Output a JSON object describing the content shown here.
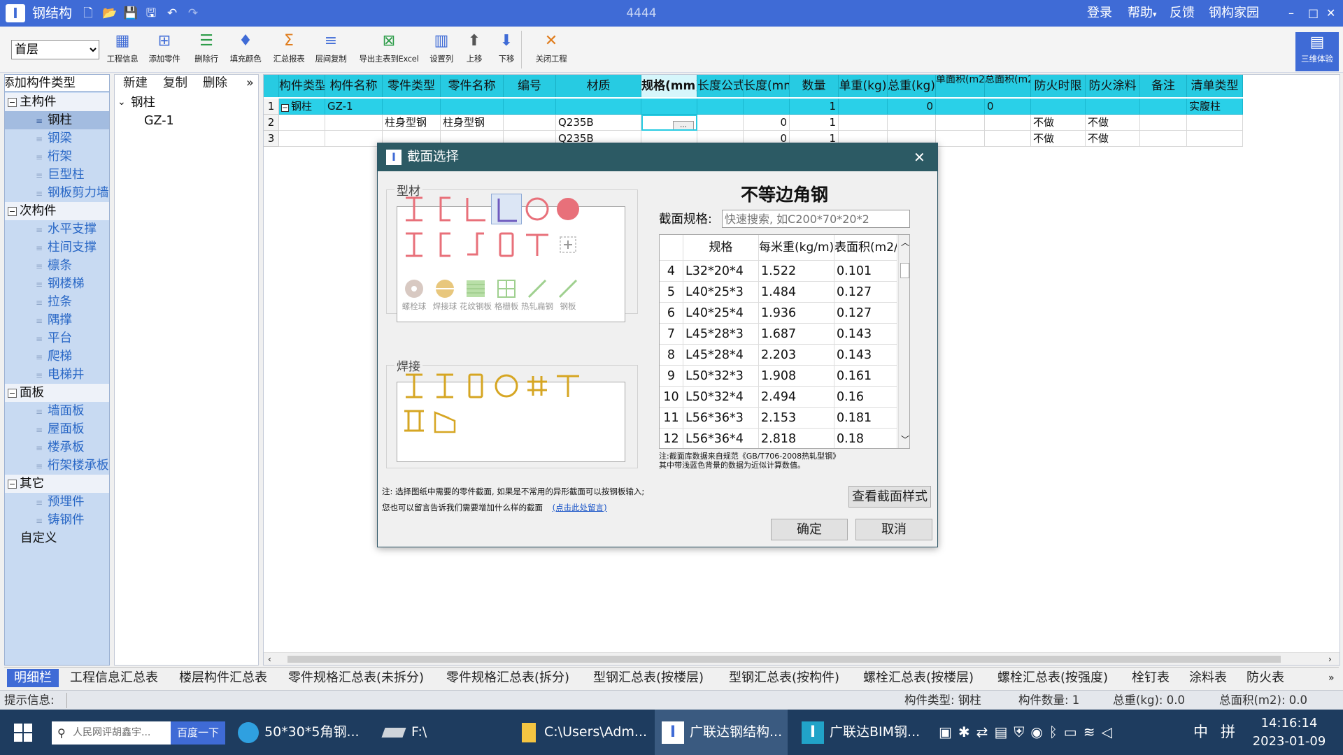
{
  "app": {
    "title": "钢结构",
    "doc_title": "4444",
    "menu": [
      "登录",
      "帮助",
      "反馈",
      "钢构家园"
    ],
    "window_controls": [
      "–",
      "□",
      "✕"
    ]
  },
  "toolbar": {
    "floor_select": "首层",
    "buttons": [
      {
        "label": "工程信息",
        "icon": "▦",
        "color": "#3f6bd6"
      },
      {
        "label": "添加零件",
        "icon": "⊞",
        "color": "#3f6bd6"
      },
      {
        "label": "删除行",
        "icon": "☰",
        "color": "#2e9d4a"
      },
      {
        "label": "填充颜色",
        "icon": "♦",
        "color": "#3f6bd6"
      },
      {
        "label": "汇总报表",
        "icon": "Σ",
        "color": "#e07b1a"
      },
      {
        "label": "层间复制",
        "icon": "≡",
        "color": "#3f6bd6"
      },
      {
        "label": "导出主表到Excel",
        "icon": "⊠",
        "color": "#2e9d4a"
      },
      {
        "label": "设置列",
        "icon": "▥",
        "color": "#3f6bd6"
      },
      {
        "label": "上移",
        "icon": "⬆",
        "color": "#555555"
      },
      {
        "label": "下移",
        "icon": "⬇",
        "color": "#3f6bd6"
      },
      {
        "label": "关闭工程",
        "icon": "✕",
        "color": "#e07b1a"
      }
    ],
    "view3d": "三维体验"
  },
  "left_tree": {
    "header": "添加构件类型",
    "items": [
      {
        "label": "主构件",
        "type": "group"
      },
      {
        "label": "钢柱",
        "type": "item",
        "selected": true
      },
      {
        "label": "钢梁",
        "type": "item"
      },
      {
        "label": "桁架",
        "type": "item"
      },
      {
        "label": "巨型柱",
        "type": "item"
      },
      {
        "label": "钢板剪力墙",
        "type": "item"
      },
      {
        "label": "次构件",
        "type": "group"
      },
      {
        "label": "水平支撑",
        "type": "item"
      },
      {
        "label": "柱间支撑",
        "type": "item"
      },
      {
        "label": "檩条",
        "type": "item"
      },
      {
        "label": "钢楼梯",
        "type": "item"
      },
      {
        "label": "拉条",
        "type": "item"
      },
      {
        "label": "隅撑",
        "type": "item"
      },
      {
        "label": "平台",
        "type": "item"
      },
      {
        "label": "爬梯",
        "type": "item"
      },
      {
        "label": "电梯井",
        "type": "item"
      },
      {
        "label": "面板",
        "type": "group"
      },
      {
        "label": "墙面板",
        "type": "item"
      },
      {
        "label": "屋面板",
        "type": "item"
      },
      {
        "label": "楼承板",
        "type": "item"
      },
      {
        "label": "桁架楼承板",
        "type": "item"
      },
      {
        "label": "其它",
        "type": "group"
      },
      {
        "label": "预埋件",
        "type": "item"
      },
      {
        "label": "铸钢件",
        "type": "item"
      },
      {
        "label": "自定义",
        "type": "plain"
      }
    ]
  },
  "mid_panel": {
    "buttons": [
      "新建",
      "复制",
      "删除",
      "»"
    ],
    "tree_root": "钢柱",
    "tree_child": "GZ-1"
  },
  "grid": {
    "columns": [
      "构件类型",
      "构件名称",
      "零件类型",
      "零件名称",
      "编号",
      "材质",
      "规格(mm)",
      "长度公式",
      "长度(mm)",
      "数量",
      "单重(kg)",
      "总重(kg)",
      "单面积(m2)",
      "总面积(m2)",
      "防火时限",
      "防火涂料",
      "备注",
      "清单类型"
    ],
    "rows": [
      [
        "1",
        "钢柱",
        "GZ-1",
        "",
        "",
        "",
        "",
        "",
        "",
        "",
        "1",
        "",
        "0",
        "",
        "0",
        "",
        "",
        "",
        "实腹柱"
      ],
      [
        "2",
        "",
        "",
        "柱身型钢",
        "柱身型钢",
        "",
        "Q235B",
        "…",
        "",
        "0",
        "1",
        "",
        "",
        "",
        "",
        "不做",
        "不做",
        "",
        ""
      ],
      [
        "3",
        "",
        "",
        "",
        "",
        "",
        "Q235B",
        "",
        "",
        "0",
        "1",
        "",
        "",
        "",
        "",
        "不做",
        "不做",
        "",
        ""
      ]
    ]
  },
  "dialog": {
    "title": "截面选择",
    "close": "✕",
    "section_profile": "型材",
    "section_weld": "焊接",
    "profile_labels": [
      "螺栓球",
      "焊接球",
      "花纹钢板",
      "格栅板",
      "热轧扁钢",
      "钢板"
    ],
    "heading": "不等边角钢",
    "search_label": "截面规格:",
    "search_placeholder": "快速搜索, 如C200*70*20*2",
    "table_cols": [
      "规格",
      "每米重(kg/m)",
      "表面积(m2/m)"
    ],
    "table_rows": [
      [
        "4",
        "L32*20*4",
        "1.522",
        "0.101"
      ],
      [
        "5",
        "L40*25*3",
        "1.484",
        "0.127"
      ],
      [
        "6",
        "L40*25*4",
        "1.936",
        "0.127"
      ],
      [
        "7",
        "L45*28*3",
        "1.687",
        "0.143"
      ],
      [
        "8",
        "L45*28*4",
        "2.203",
        "0.143"
      ],
      [
        "9",
        "L50*32*3",
        "1.908",
        "0.161"
      ],
      [
        "10",
        "L50*32*4",
        "2.494",
        "0.16"
      ],
      [
        "11",
        "L56*36*3",
        "2.153",
        "0.181"
      ],
      [
        "12",
        "L56*36*4",
        "2.818",
        "0.18"
      ]
    ],
    "table_note1": "注:截面库数据来自规范《GB/T706-2008热轧型钢》",
    "table_note2": "其中带浅蓝色背景的数据为近似计算数值。",
    "note1": "注: 选择图纸中需要的零件截面, 如果是不常用的异形截面可以按钢板输入;",
    "note2": "您也可以留言告诉我们需要增加什么样的截面",
    "note_link": "(点击此处留言)",
    "view_style": "查看截面样式",
    "ok": "确定",
    "cancel": "取消"
  },
  "bottom_tabs": [
    "明细栏",
    "工程信息汇总表",
    "楼层构件汇总表",
    "零件规格汇总表(未拆分)",
    "零件规格汇总表(拆分)",
    "型钢汇总表(按楼层)",
    "型钢汇总表(按构件)",
    "螺栓汇总表(按楼层)",
    "螺栓汇总表(按强度)",
    "栓钉表",
    "涂料表",
    "防火表"
  ],
  "status": {
    "hint_label": "提示信息:",
    "type": "构件类型: 钢柱",
    "count": "构件数量: 1",
    "weight": "总重(kg): 0.0",
    "area": "总面积(m2): 0.0"
  },
  "taskbar": {
    "search_placeholder": "人民网评胡鑫宇...",
    "search_button": "百度一下",
    "tasks": [
      "50*30*5角钢...",
      "F:\\",
      "C:\\Users\\Adm...",
      "广联达钢结构...",
      "广联达BIM钢..."
    ],
    "ime": "中",
    "time": "14:16:14",
    "date": "2023-01-09"
  },
  "colors": {
    "accent": "#3f6bd6",
    "grid_header": "#27cbe2",
    "row_selected": "#2ad0e8",
    "profile_shape": "#e8707a",
    "weld_shape": "#d6a623",
    "dialog_title": "#2c5a64"
  }
}
